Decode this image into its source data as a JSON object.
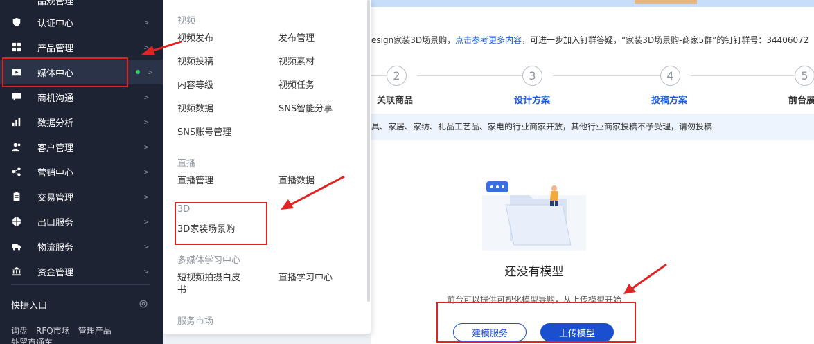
{
  "sidebar": {
    "top_cut_label": "品规管理",
    "items": [
      {
        "label": "认证中心",
        "icon": "shield-icon"
      },
      {
        "label": "产品管理",
        "icon": "grid-icon"
      },
      {
        "label": "媒体中心",
        "icon": "media-icon",
        "active": true
      },
      {
        "label": "商机沟通",
        "icon": "chat-icon"
      },
      {
        "label": "数据分析",
        "icon": "bar-chart-icon"
      },
      {
        "label": "客户管理",
        "icon": "users-icon"
      },
      {
        "label": "营销中心",
        "icon": "share-icon"
      },
      {
        "label": "交易管理",
        "icon": "clipboard-icon"
      },
      {
        "label": "出口服务",
        "icon": "globe-icon"
      },
      {
        "label": "物流服务",
        "icon": "truck-icon"
      },
      {
        "label": "资金管理",
        "icon": "bank-icon"
      }
    ],
    "chevron": ">",
    "quick_title": "快捷入口",
    "quick_links": [
      "询盘",
      "RFQ市场",
      "管理产品"
    ],
    "quick_more": "外贸直通车"
  },
  "dropdown": {
    "video_section": "视频",
    "video_links": [
      "视频发布",
      "发布管理",
      "视频投稿",
      "视频素材",
      "内容等级",
      "视频任务",
      "视频数据",
      "SNS智能分享",
      "SNS账号管理"
    ],
    "live_section": "直播",
    "live_links": [
      "直播管理",
      "直播数据"
    ],
    "three_d_section": "3D",
    "three_d_link": "3D家装场景购",
    "learn_section": "多媒体学习中心",
    "learn_links": [
      "短视频拍摄白皮书",
      "直播学习中心"
    ],
    "market_section": "服务市场"
  },
  "main": {
    "notice_prefix": "esign家装3D场景购，",
    "notice_link": "点击参考更多内容",
    "notice_suffix": "，可进一步加入钉群答疑，“家装3D场景购-商家5群”的钉钉群号：34406072",
    "steps": [
      {
        "num": "2",
        "label": "关联商品"
      },
      {
        "num": "3",
        "label": "设计方案"
      },
      {
        "num": "4",
        "label": "投稿方案"
      },
      {
        "num": "5",
        "label": "前台展"
      }
    ],
    "info_text": "具、家居、家纺、礼品工艺品、家电的行业商家开放，其他行业商家投稿不予受理，请勿投稿",
    "empty_title": "还没有模型",
    "empty_desc": "前台可以提供可视化模型导购，从上传模型开始",
    "btn_build": "建模服务",
    "btn_upload": "上传模型"
  },
  "colors": {
    "sidebar_bg": "#1d2333",
    "accent_blue": "#1a4fcf",
    "annotation_red": "#e02424",
    "active_dot": "#3ccf7a"
  }
}
